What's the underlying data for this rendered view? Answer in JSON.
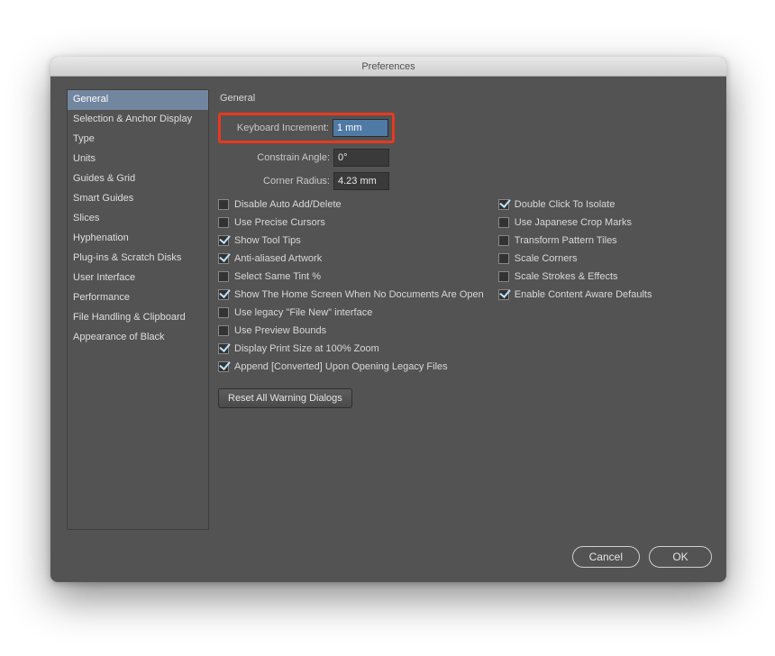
{
  "window": {
    "title": "Preferences"
  },
  "sidebar": {
    "items": [
      "General",
      "Selection & Anchor Display",
      "Type",
      "Units",
      "Guides & Grid",
      "Smart Guides",
      "Slices",
      "Hyphenation",
      "Plug-ins & Scratch Disks",
      "User Interface",
      "Performance",
      "File Handling & Clipboard",
      "Appearance of Black"
    ],
    "active_index": 0
  },
  "panel": {
    "title": "General",
    "fields": {
      "keyboard_increment": {
        "label": "Keyboard Increment:",
        "value": "1 mm",
        "highlighted": true
      },
      "constrain_angle": {
        "label": "Constrain Angle:",
        "value": "0°"
      },
      "corner_radius": {
        "label": "Corner Radius:",
        "value": "4.23 mm"
      }
    },
    "checks_left": [
      {
        "label": "Disable Auto Add/Delete",
        "checked": false
      },
      {
        "label": "Use Precise Cursors",
        "checked": false
      },
      {
        "label": "Show Tool Tips",
        "checked": true
      },
      {
        "label": "Anti-aliased Artwork",
        "checked": true
      },
      {
        "label": "Select Same Tint %",
        "checked": false
      },
      {
        "label": "Show The Home Screen When No Documents Are Open",
        "checked": true
      },
      {
        "label": "Use legacy \"File New\" interface",
        "checked": false
      },
      {
        "label": "Use Preview Bounds",
        "checked": false
      },
      {
        "label": "Display Print Size at 100% Zoom",
        "checked": true
      },
      {
        "label": "Append [Converted] Upon Opening Legacy Files",
        "checked": true
      }
    ],
    "checks_right": [
      {
        "label": "Double Click To Isolate",
        "checked": true
      },
      {
        "label": "Use Japanese Crop Marks",
        "checked": false
      },
      {
        "label": "Transform Pattern Tiles",
        "checked": false
      },
      {
        "label": "Scale Corners",
        "checked": false
      },
      {
        "label": "Scale Strokes & Effects",
        "checked": false
      },
      {
        "label": "Enable Content Aware Defaults",
        "checked": true
      }
    ],
    "reset_button": "Reset All Warning Dialogs"
  },
  "footer": {
    "cancel": "Cancel",
    "ok": "OK"
  }
}
